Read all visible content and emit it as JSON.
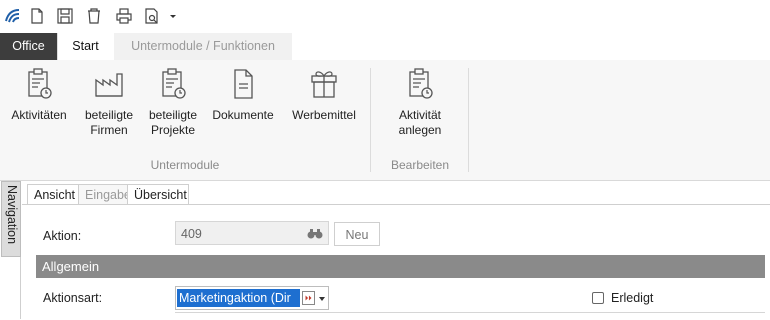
{
  "ribbon_tabs": {
    "office": "Office",
    "start": "Start",
    "untermodule": "Untermodule / Funktionen"
  },
  "ribbon": {
    "buttons": [
      {
        "line1": "Aktivitäten",
        "line2": ""
      },
      {
        "line1": "beteiligte",
        "line2": "Firmen"
      },
      {
        "line1": "beteiligte",
        "line2": "Projekte"
      },
      {
        "line1": "Dokumente",
        "line2": ""
      },
      {
        "line1": "Werbemittel",
        "line2": ""
      },
      {
        "line1": "Aktivität",
        "line2": "anlegen"
      }
    ],
    "groups": {
      "untermodule": "Untermodule",
      "bearbeiten": "Bearbeiten"
    }
  },
  "navigation": {
    "label": "Navigation"
  },
  "subtabs": {
    "ansicht": "Ansicht",
    "eingabe": "Eingabe",
    "uebersicht": "Übersicht"
  },
  "form": {
    "aktion_label": "Aktion:",
    "aktion_value": "409",
    "neu_button": "Neu",
    "section_title": "Allgemein",
    "aktionsart_label": "Aktionsart:",
    "aktionsart_value": "Marketingaktion (Dir",
    "erledigt_label": "Erledigt"
  },
  "colors": {
    "office_tab": "#3d3d3d",
    "section_header": "#8a8a8a",
    "selection": "#1e6fd0"
  }
}
